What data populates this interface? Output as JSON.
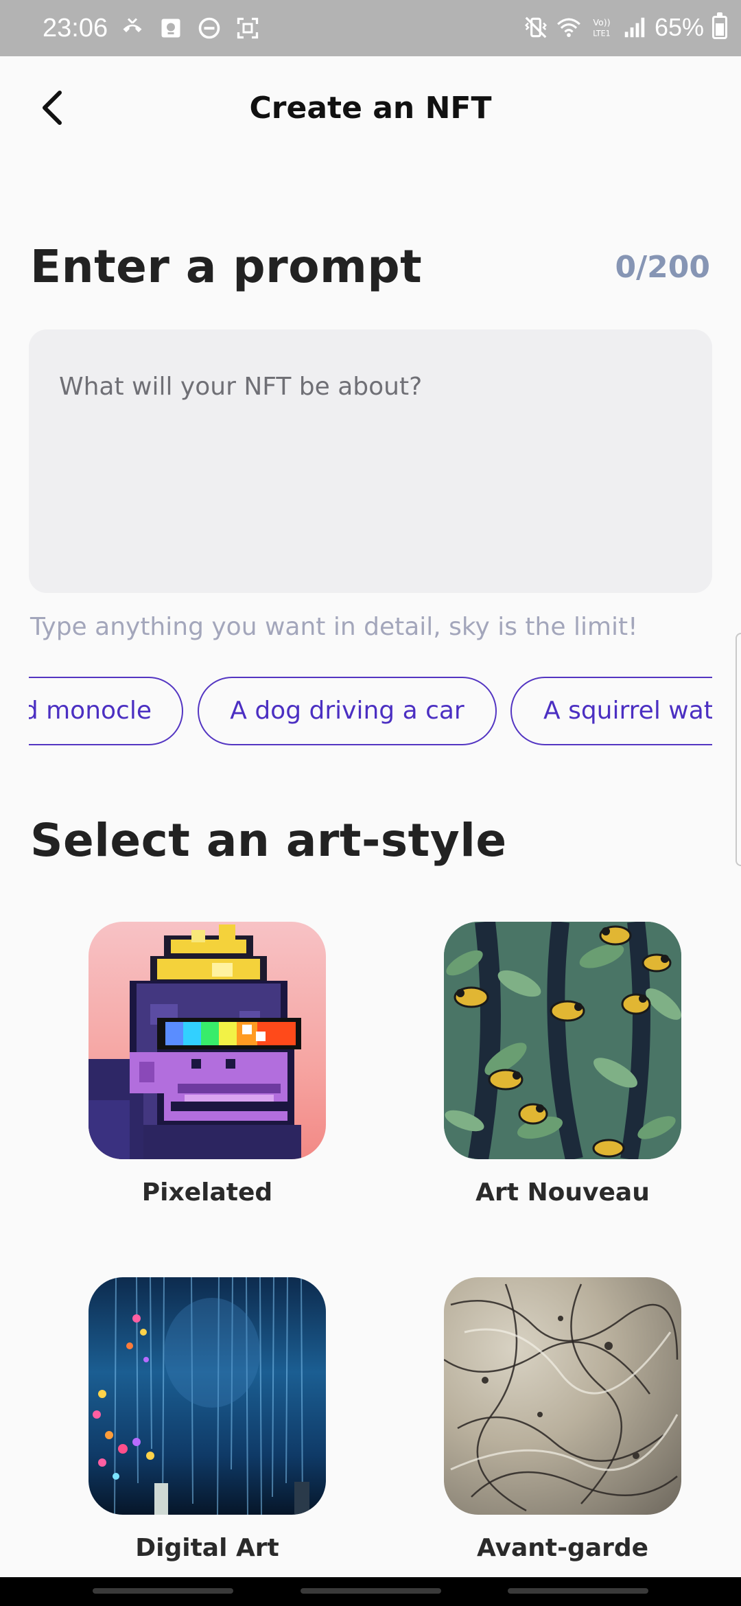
{
  "status_bar": {
    "time": "23:06",
    "battery": "65%",
    "left_icons": [
      "call-icon",
      "photo-icon",
      "do-not-disturb-icon",
      "screenshot-icon"
    ],
    "right_icons": [
      "vibrate-icon",
      "wifi-icon",
      "volte-icon",
      "signal-icon",
      "battery-icon"
    ],
    "volte_label": "Vo))\nLTE1"
  },
  "header": {
    "title": "Create an NFT",
    "back_icon": "back-arrow-icon"
  },
  "prompt": {
    "heading": "Enter a prompt",
    "char_count": "0/200",
    "placeholder": "What will your NFT be about?",
    "helper": "Type anything you want in detail, sky is the limit!"
  },
  "suggestions": [
    "d monocle",
    "A dog driving a car",
    "A squirrel wat"
  ],
  "art_style": {
    "heading": "Select an art-style",
    "items": [
      {
        "label": "Pixelated"
      },
      {
        "label": "Art Nouveau"
      },
      {
        "label": "Digital Art"
      },
      {
        "label": "Avant-garde"
      }
    ]
  },
  "colors": {
    "accent": "#5335c2",
    "counter": "#8695b4",
    "prompt_bg": "#efeff1",
    "status_bar_bg": "#b3b3b3"
  }
}
